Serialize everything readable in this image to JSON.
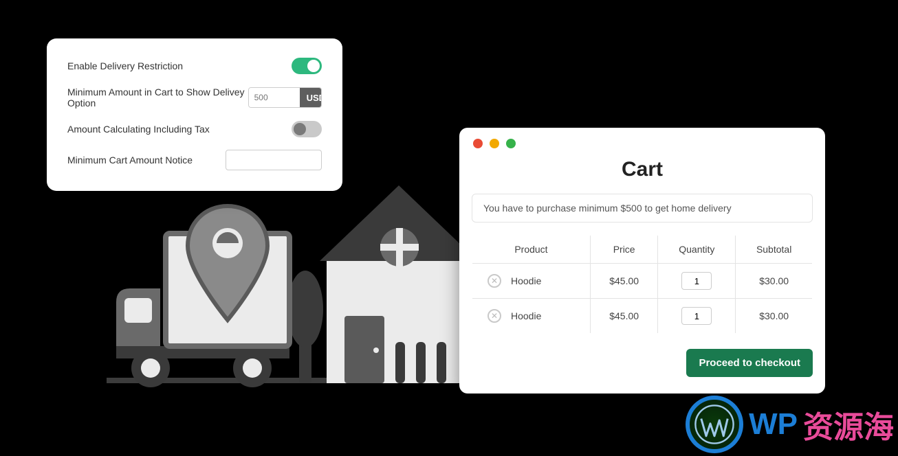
{
  "settings": {
    "enable_restriction_label": "Enable Delivery Restriction",
    "enable_restriction_on": true,
    "min_amount_label": "Minimum Amount in Cart to Show Delivey Option",
    "min_amount_placeholder": "500",
    "min_amount_currency": "USD",
    "include_tax_label": "Amount Calculating Including Tax",
    "include_tax_on": false,
    "notice_label": "Minimum Cart Amount Notice"
  },
  "cart": {
    "title": "Cart",
    "notice": "You have to purchase minimum $500 to get home delivery",
    "headers": {
      "product": "Product",
      "price": "Price",
      "quantity": "Quantity",
      "subtotal": "Subtotal"
    },
    "items": [
      {
        "product": "Hoodie",
        "price": "$45.00",
        "quantity": "1",
        "subtotal": "$30.00"
      },
      {
        "product": "Hoodie",
        "price": "$45.00",
        "quantity": "1",
        "subtotal": "$30.00"
      }
    ],
    "checkout_label": "Proceed to checkout"
  },
  "watermark": {
    "wp": "WP",
    "cn": "资源海"
  }
}
